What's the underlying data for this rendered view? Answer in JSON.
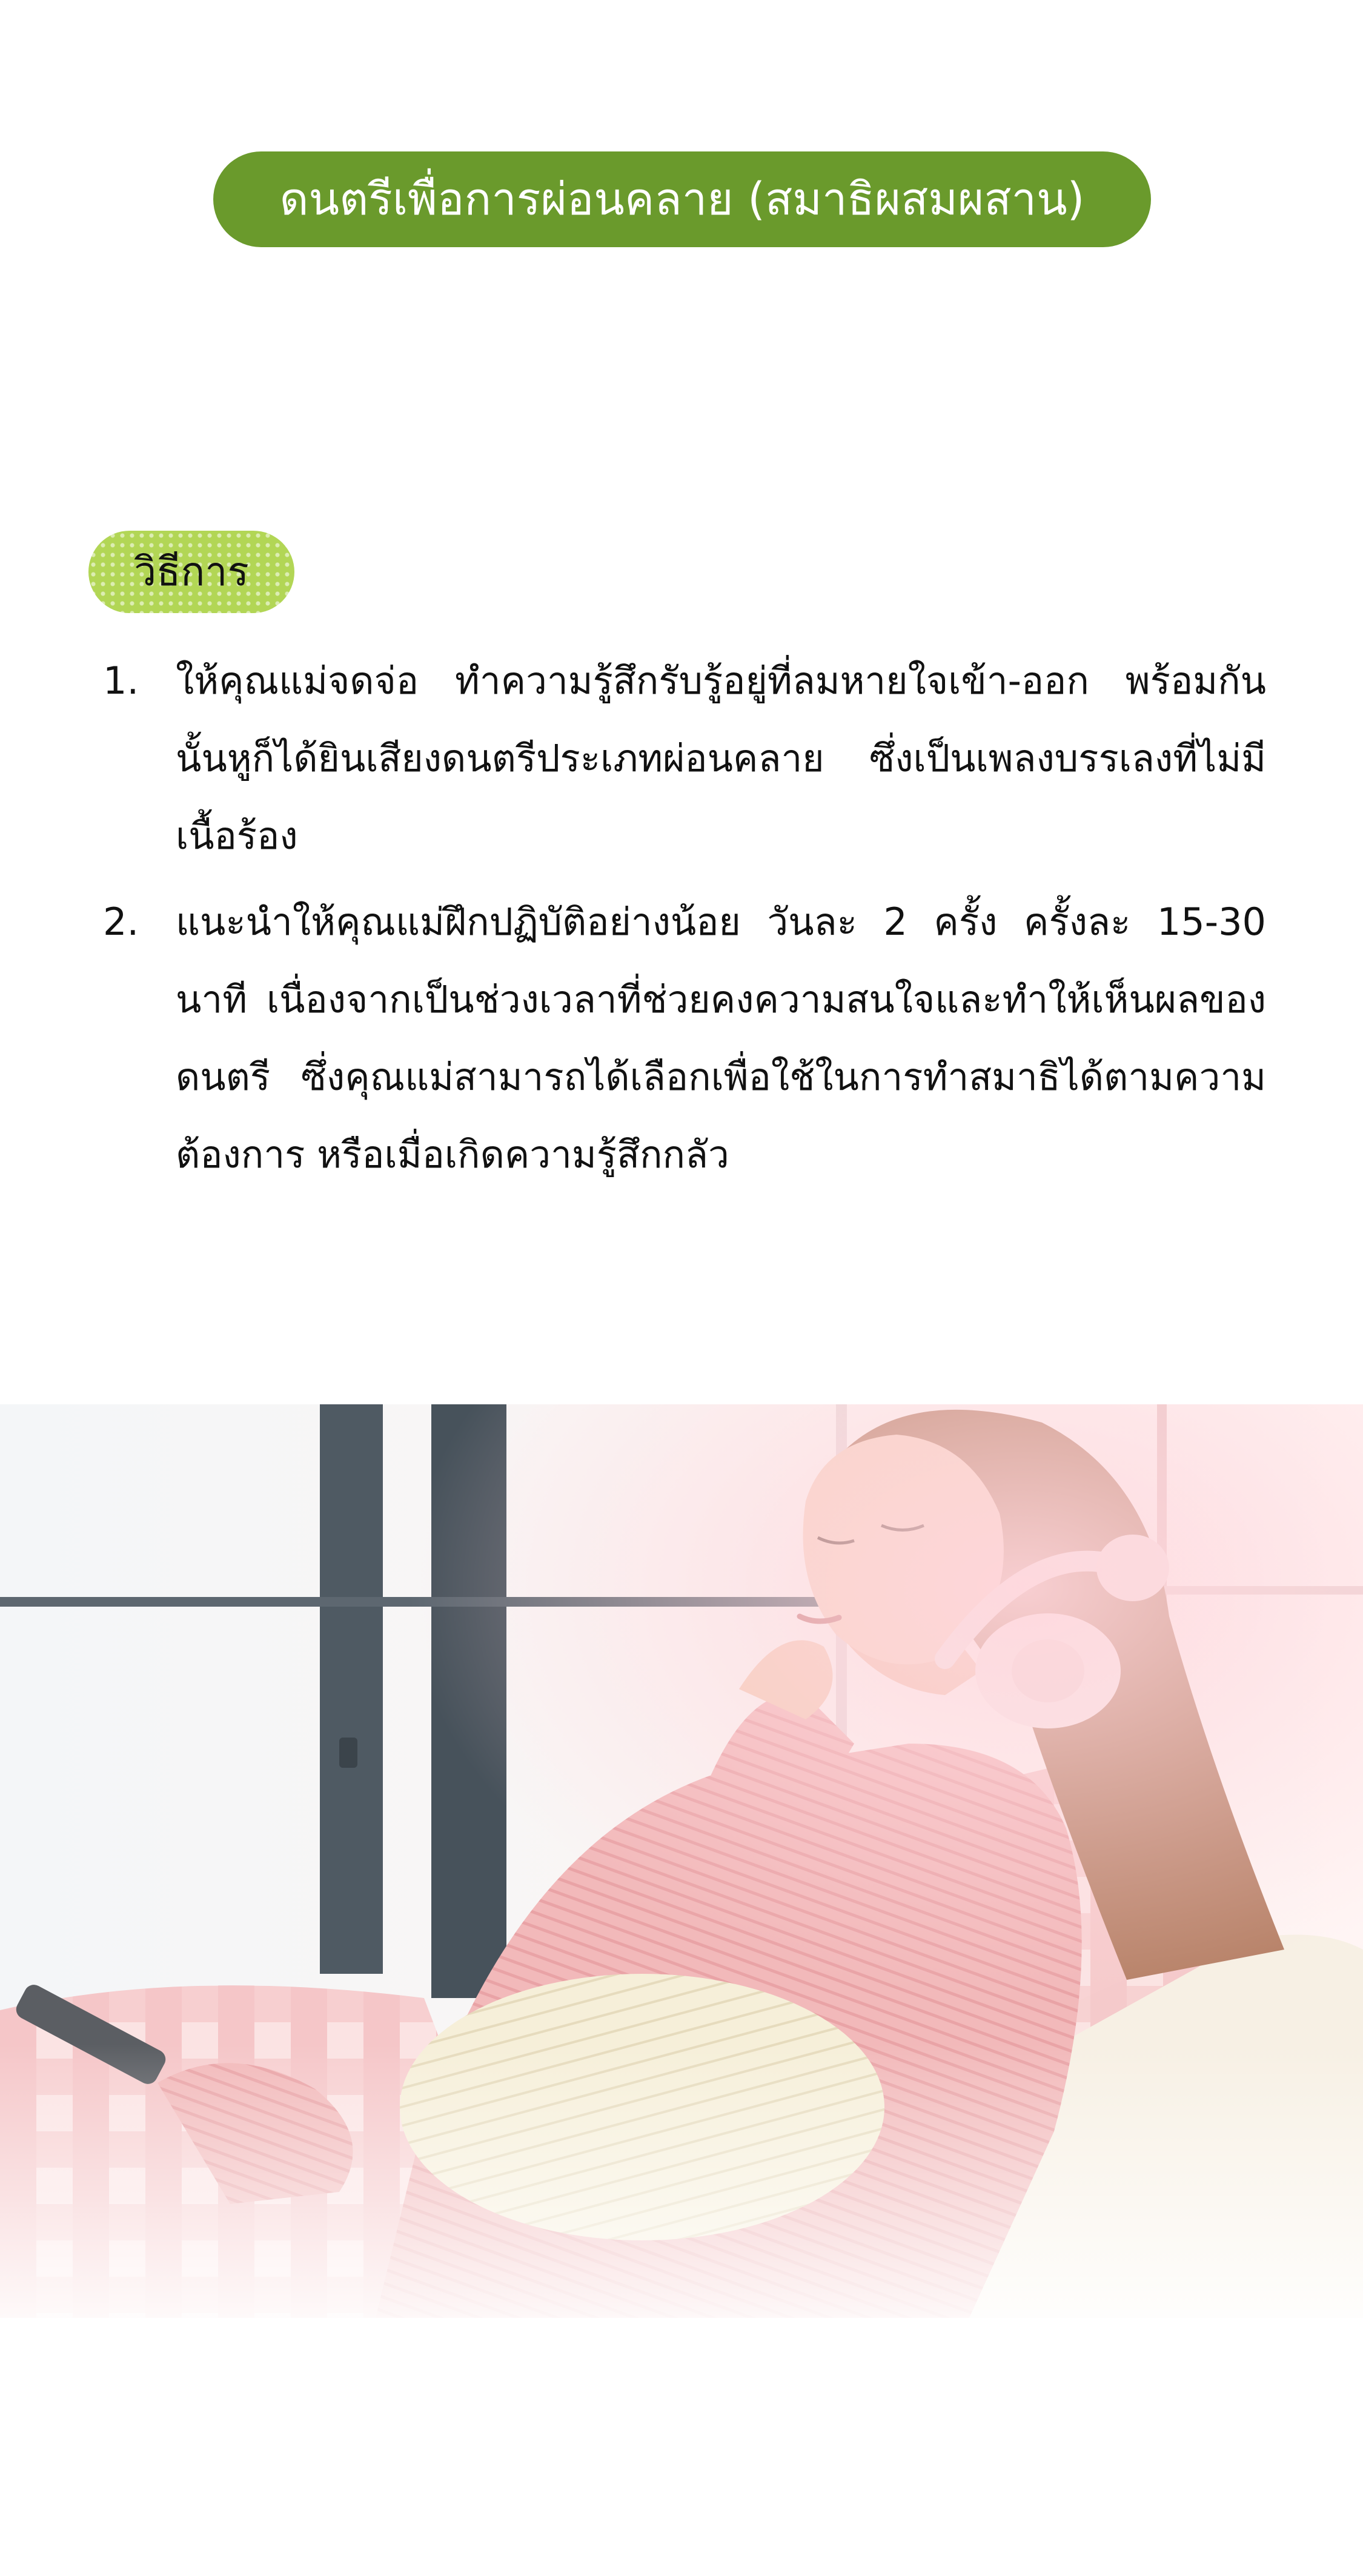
{
  "header": {
    "title": "ดนตรีเพื่อการผ่อนคลาย (สมาธิผสมผสาน)"
  },
  "method": {
    "label": "วิธีการ",
    "steps": [
      {
        "number": "1.",
        "text": "ให้คุณแม่จดจ่อ ทำความรู้สึกรับรู้อยู่ที่ลมหายใจเข้า-ออก พร้อมกันนั้นหูก็ได้ยินเสียงดนตรีประเภทผ่อนคลาย ซึ่งเป็นเพลงบรรเลงที่ไม่มีเนื้อร้อง"
      },
      {
        "number": "2.",
        "text": "แนะนำให้คุณแม่ฝึกปฏิบัติอย่างน้อย วันละ 2 ครั้ง ครั้งละ 15-30 นาที เนื่องจากเป็นช่วงเวลาที่ช่วยคงความสนใจและทำให้เห็นผลของดนตรี ซึ่งคุณแม่สามารถได้เลือกเพื่อใช้ในการทำสมาธิได้ตามความต้องการ หรือเมื่อเกิดความรู้สึกกลัว"
      }
    ]
  },
  "colors": {
    "title_bg": "#6a9a2c",
    "badge_bg": "#b2d655",
    "text": "#111111"
  }
}
